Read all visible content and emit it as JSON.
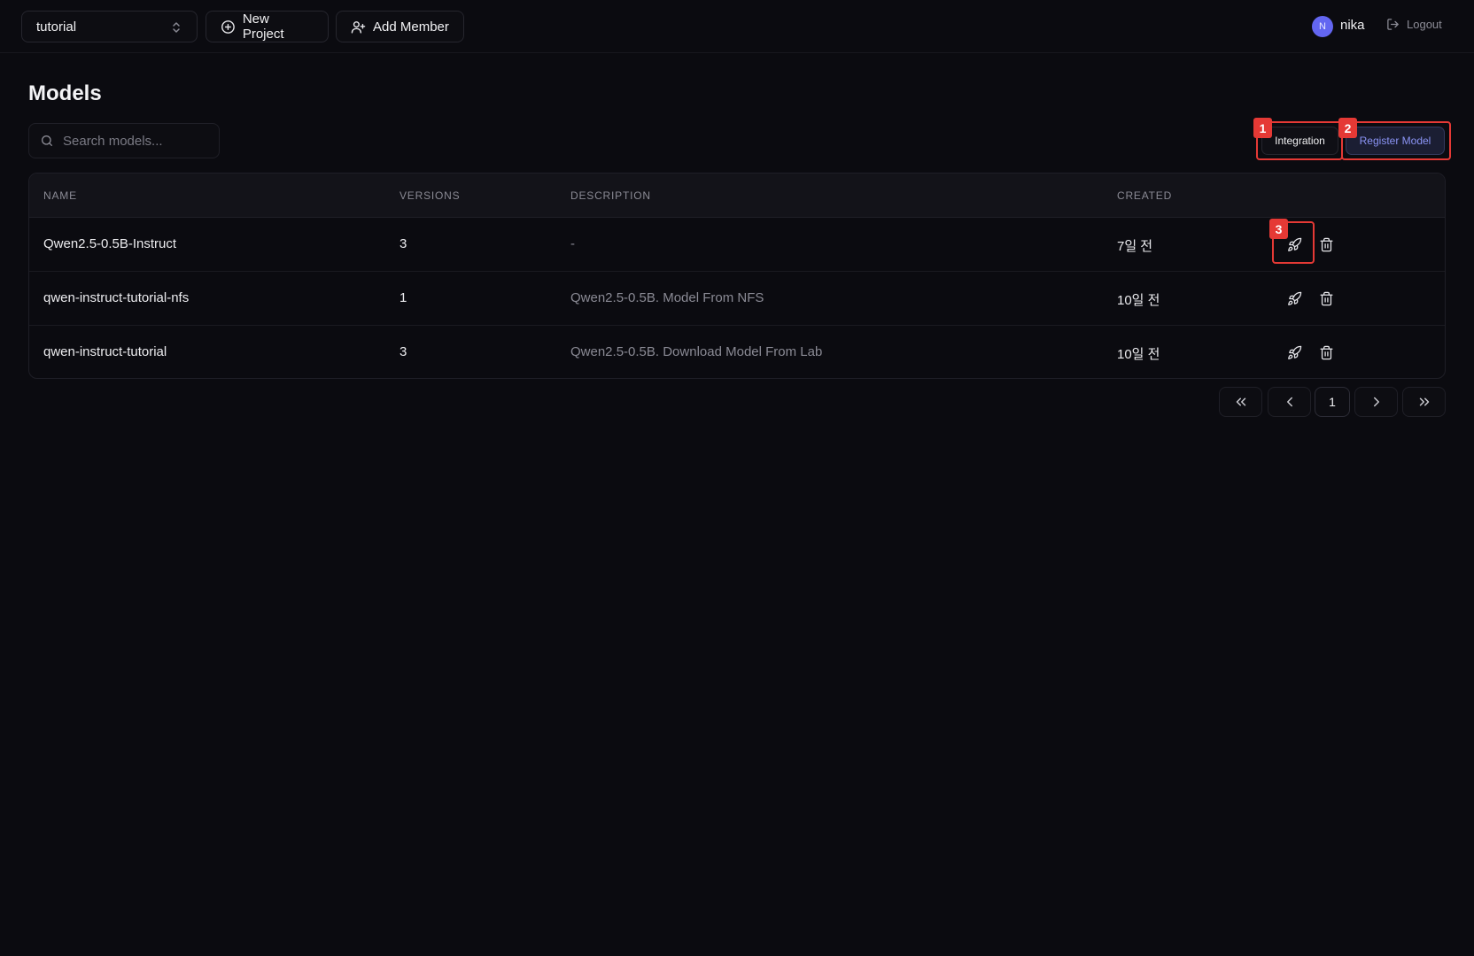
{
  "topbar": {
    "project": "tutorial",
    "new_project_label": "New Project",
    "add_member_label": "Add Member",
    "user_initial": "N",
    "username": "nika",
    "logout_label": "Logout"
  },
  "page": {
    "title": "Models",
    "search_placeholder": "Search models...",
    "integration_label": "Integration",
    "register_label": "Register Model"
  },
  "table": {
    "columns": [
      "NAME",
      "VERSIONS",
      "DESCRIPTION",
      "CREATED"
    ],
    "rows": [
      {
        "name": "Qwen2.5-0.5B-Instruct",
        "versions": "3",
        "description": "-",
        "created": "7일 전"
      },
      {
        "name": "qwen-instruct-tutorial-nfs",
        "versions": "1",
        "description": "Qwen2.5-0.5B. Model From NFS",
        "created": "10일 전"
      },
      {
        "name": "qwen-instruct-tutorial",
        "versions": "3",
        "description": "Qwen2.5-0.5B. Download Model From Lab",
        "created": "10일 전"
      }
    ]
  },
  "pagination": {
    "current_page": "1"
  },
  "annotations": [
    "1",
    "2",
    "3"
  ],
  "colors": {
    "background": "#0b0b10",
    "accent": "#8b94f5",
    "avatar": "#6366f1",
    "annotation": "#e53935"
  }
}
